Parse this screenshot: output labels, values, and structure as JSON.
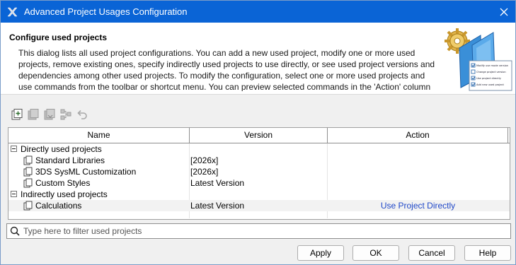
{
  "window": {
    "title": "Advanced Project Usages Configuration"
  },
  "header": {
    "title": "Configure used projects",
    "description": "This dialog lists all used project configurations. You can add a new used project, modify one or more used projects, remove existing ones, specify indirectly used projects to use directly, or see used project versions and dependencies among other used projects. To modify the configuration, select one or more used projects and use commands from the toolbar or shortcut menu. You can preview selected commands in the 'Action' column before",
    "graphic_items": [
      "Modify use mode version",
      "Change project version",
      "Use project directly",
      "Add new used project"
    ]
  },
  "toolbar": {
    "icons": [
      "add-used-project-icon",
      "remove-used-project-icon",
      "import-project-icon",
      "dependencies-icon",
      "undo-icon"
    ]
  },
  "table": {
    "columns": [
      "Name",
      "Version",
      "Action"
    ],
    "rows": [
      {
        "type": "group",
        "name": "Directly used projects",
        "version": "",
        "action": ""
      },
      {
        "type": "item",
        "name": "Standard Libraries",
        "version": "[2026x]",
        "action": ""
      },
      {
        "type": "item",
        "name": "3DS SysML Customization",
        "version": "[2026x]",
        "action": ""
      },
      {
        "type": "item",
        "name": "Custom Styles",
        "version": "Latest Version",
        "action": ""
      },
      {
        "type": "group",
        "name": "Indirectly used projects",
        "version": "",
        "action": ""
      },
      {
        "type": "item",
        "name": "Calculations",
        "version": "Latest Version",
        "action": "Use Project Directly"
      }
    ]
  },
  "filter": {
    "placeholder": "Type here to filter used projects",
    "value": ""
  },
  "buttons": {
    "apply": "Apply",
    "ok": "OK",
    "cancel": "Cancel",
    "help": "Help"
  },
  "colors": {
    "titlebar": "#0a64d6",
    "link": "#1f47c8",
    "selected_row": "#f2f2f2"
  }
}
